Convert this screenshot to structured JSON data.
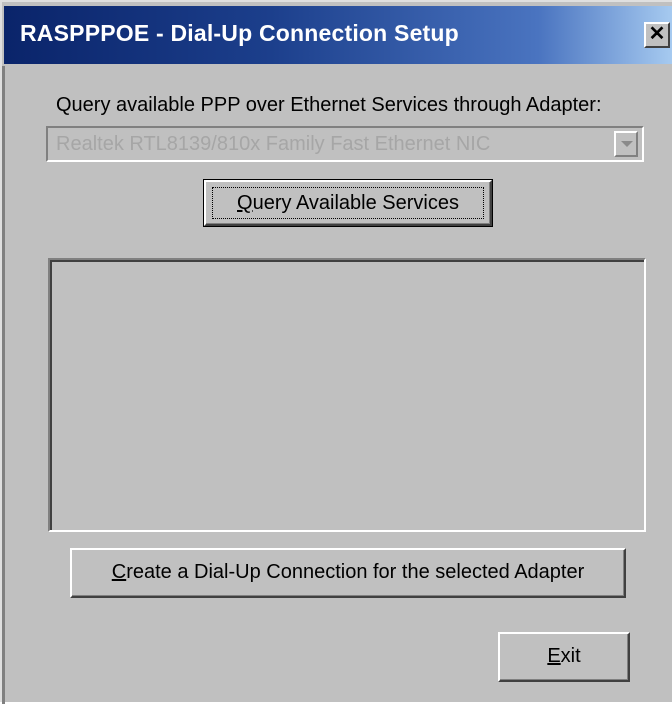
{
  "window": {
    "title": "RASPPPOE - Dial-Up Connection Setup",
    "close_symbol": "✕",
    "close_icon": "close-icon"
  },
  "query_section": {
    "label": "Query available PPP over Ethernet Services through Adapter:",
    "adapter_selected": "Realtek RTL8139/810x Family Fast Ethernet NIC",
    "adapter_disabled": true,
    "dropdown_icon": "chevron-down-icon"
  },
  "buttons": {
    "query_label": "Query Available Services",
    "query_mnemonic": "Q",
    "create_label": "Create a Dial-Up Connection for the selected Adapter",
    "create_mnemonic": "C",
    "exit_label": "Exit",
    "exit_mnemonic": "E"
  },
  "services_list": {
    "items": []
  },
  "colors": {
    "face": "#c0c0c0",
    "title_start": "#0a246a",
    "title_end": "#a6caf0",
    "disabled_text": "#a6a6a6"
  }
}
